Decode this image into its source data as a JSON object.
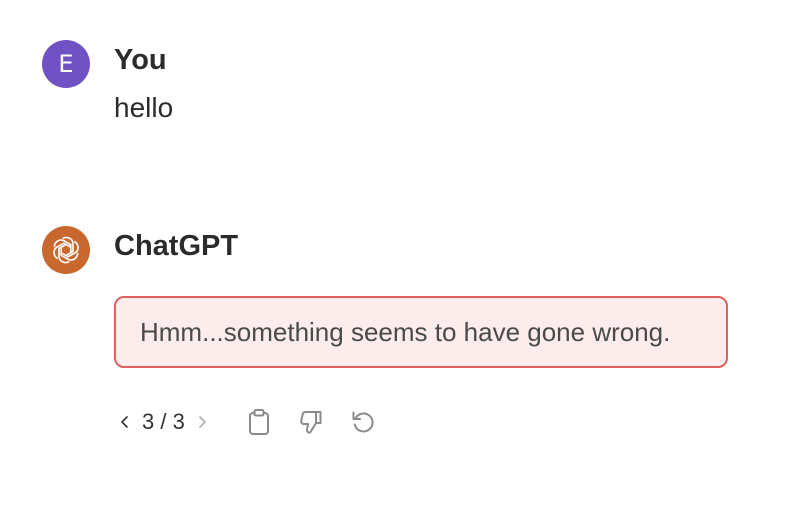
{
  "conversation": {
    "user": {
      "avatar_initial": "E",
      "author": "You",
      "message": "hello"
    },
    "assistant": {
      "author": "ChatGPT",
      "avatar_icon": "openai-logo-icon",
      "error_message": "Hmm...something seems to have gone wrong.",
      "pager": {
        "current": "3",
        "total": "3",
        "label": "3 / 3"
      },
      "actions": {
        "copy_icon": "clipboard-icon",
        "feedback_icon": "thumbs-down-icon",
        "regenerate_icon": "regenerate-icon"
      }
    }
  },
  "colors": {
    "user_avatar": "#7152c4",
    "assistant_avatar": "#c8682f",
    "error_border": "#e06060",
    "error_background": "#fcecec"
  }
}
